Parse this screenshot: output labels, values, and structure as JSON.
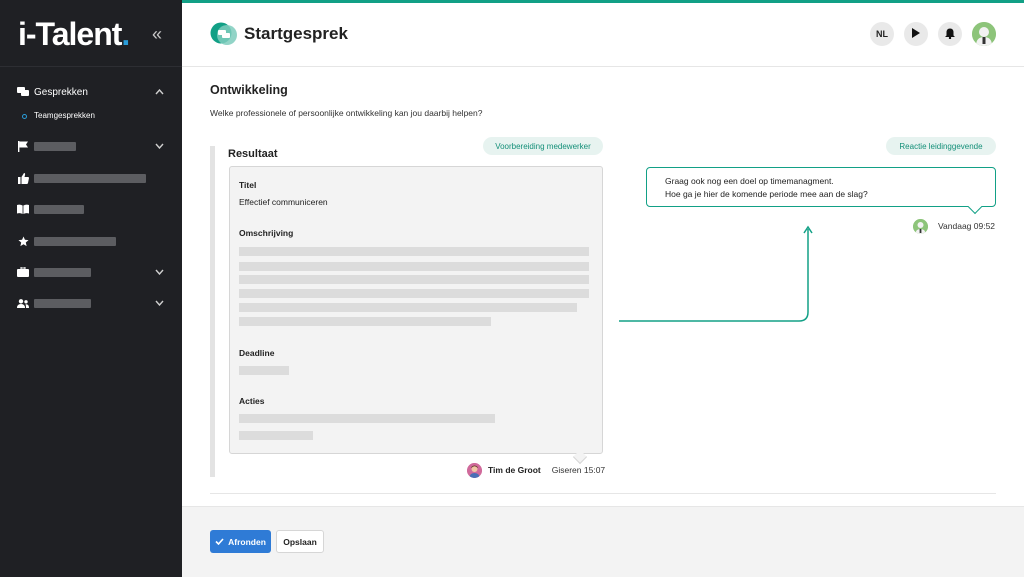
{
  "sidebar": {
    "logo_text": "i-Talent",
    "logo_dot": ".",
    "collapse_icon": "double-chevron-left-icon",
    "items": [
      {
        "label": "Gesprekken",
        "icon": "chat-bubbles-icon",
        "expanded": true
      },
      {
        "label": "",
        "icon": "flag-icon",
        "expandable": true
      },
      {
        "label": "",
        "icon": "thumbs-up-icon"
      },
      {
        "label": "",
        "icon": "book-icon"
      },
      {
        "label": "",
        "icon": "star-icon"
      },
      {
        "label": "",
        "icon": "briefcase-icon",
        "expandable": true
      },
      {
        "label": "",
        "icon": "people-icon",
        "expandable": true
      }
    ],
    "subitems": [
      {
        "label": "Teamgesprekken"
      }
    ]
  },
  "header": {
    "title": "Startgesprek",
    "language": "NL"
  },
  "content": {
    "section_title": "Ontwikkeling",
    "question": "Welke professionele of persoonlijke ontwikkeling kan jou daarbij helpen?",
    "employee_pill": "Voorbereiding medewerker",
    "manager_pill": "Reactie leidinggevende",
    "result_title": "Resultaat",
    "fields": {
      "title_label": "Titel",
      "title_value": "Effectief communiceren",
      "description_label": "Omschrijving",
      "deadline_label": "Deadline",
      "actions_label": "Acties"
    },
    "author": {
      "name": "Tim de Groot",
      "time": "Giseren 15:07"
    },
    "reply": {
      "line1": "Graag ook nog een doel op timemanagment.",
      "line2": "Hoe ga je hier de komende periode mee aan de slag?",
      "time": "Vandaag 09:52"
    }
  },
  "footer": {
    "finish_label": "Afronden",
    "save_label": "Opslaan"
  },
  "colors": {
    "accent": "#12a086",
    "primary_button": "#2f7bd6",
    "sidebar_bg": "#1f2024",
    "logo_dot": "#2a9cd8"
  }
}
